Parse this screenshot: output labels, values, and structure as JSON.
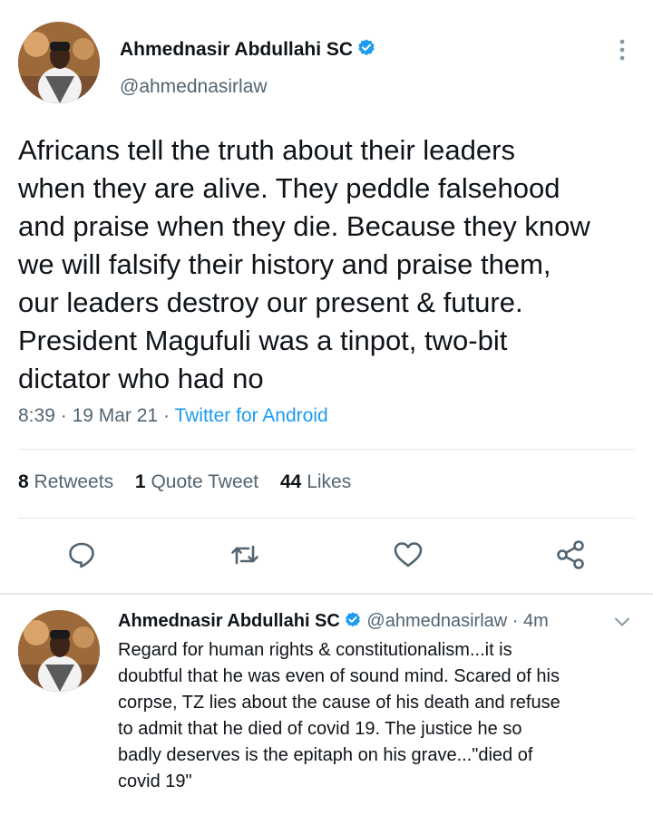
{
  "main_tweet": {
    "author_name": "Ahmednasir Abdullahi SC",
    "author_handle": "@ahmednasirlaw",
    "text": "Africans tell the truth about their leaders\nwhen they are alive. They peddle falsehood\nand praise when they die. Because they know\nwe will falsify their history and praise them,\nour leaders destroy our present & future.\nPresident Magufuli was a tinpot, two-bit\ndictator who had no",
    "time": "8:39",
    "separator": "·",
    "date": "19 Mar 21",
    "source": "Twitter for Android",
    "stats": {
      "retweets_count": "8",
      "retweets_label": "Retweets",
      "quotes_count": "1",
      "quotes_label": "Quote Tweet",
      "likes_count": "44",
      "likes_label": "Likes"
    },
    "actions": [
      "reply-icon",
      "retweet-icon",
      "like-icon",
      "share-icon"
    ]
  },
  "reply_tweet": {
    "author_name": "Ahmednasir Abdullahi SC",
    "author_handle": "@ahmednasirlaw",
    "separator": "·",
    "age": "4m",
    "text": "Regard for human rights & constitutionalism...it is\ndoubtful that he was even of sound mind. Scared of his\ncorpse, TZ lies about the cause of his death and refuse\nto admit that he died of covid 19. The justice he so\nbadly deserves is the epitaph on his grave...\"died of\ncovid 19\""
  },
  "colors": {
    "text": "#0f1419",
    "secondary": "#536471",
    "accent": "#1d9bf0",
    "divider": "#e1e8ed"
  }
}
